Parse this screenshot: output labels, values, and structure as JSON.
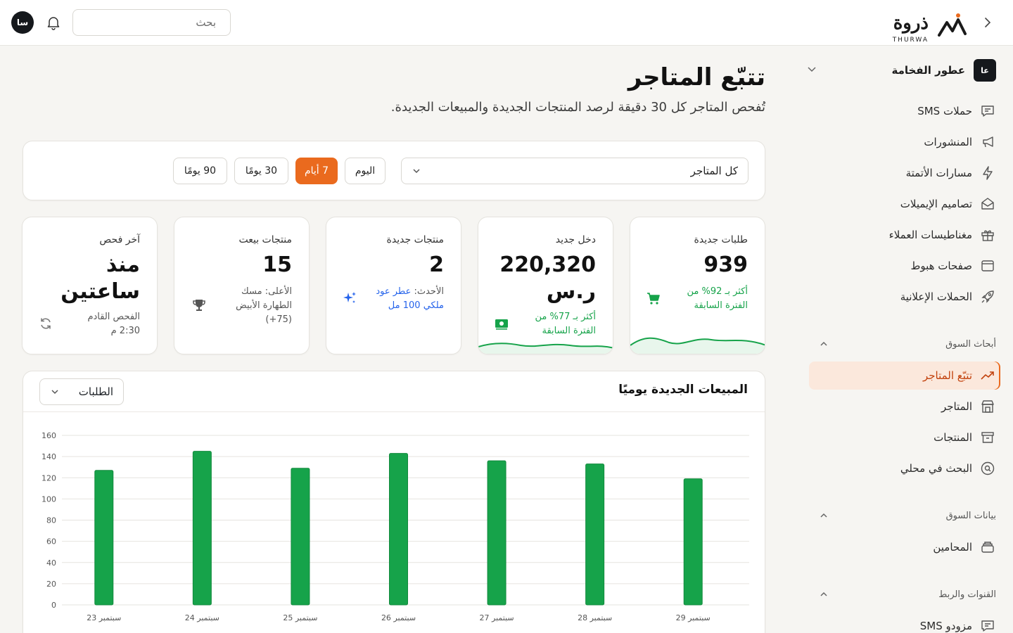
{
  "brand": {
    "name": "ذروة",
    "latin": "THURWA"
  },
  "header": {
    "search_placeholder": "بحث",
    "avatar_initials": "سا"
  },
  "sidebar": {
    "store": {
      "badge": "عا",
      "name": "عطور الفخامة"
    },
    "items": [
      {
        "label": "حملات SMS",
        "icon": "message-icon"
      },
      {
        "label": "المنشورات",
        "icon": "megaphone-icon"
      },
      {
        "label": "مسارات الأتمتة",
        "icon": "lightning-icon"
      },
      {
        "label": "تصاميم الإيميلات",
        "icon": "envelope-icon"
      },
      {
        "label": "مغناطيسات العملاء",
        "icon": "gift-icon"
      },
      {
        "label": "صفحات هبوط",
        "icon": "browser-icon"
      },
      {
        "label": "الحملات الإعلانية",
        "icon": "rocket-icon"
      }
    ],
    "sections": [
      {
        "title": "أبحاث السوق",
        "items": [
          {
            "label": "تتبّع المتاجر",
            "icon": "trend-icon",
            "active": true
          },
          {
            "label": "المتاجر",
            "icon": "store-icon"
          },
          {
            "label": "المنتجات",
            "icon": "archive-icon"
          },
          {
            "label": "البحث في محلي",
            "icon": "search-circle-icon"
          }
        ]
      },
      {
        "title": "بيانات السوق",
        "items": [
          {
            "label": "المحامين",
            "icon": "stack-icon"
          }
        ]
      },
      {
        "title": "القنوات والربط",
        "items": [
          {
            "label": "مزودو SMS",
            "icon": "message-icon"
          }
        ]
      }
    ]
  },
  "page": {
    "title": "تتبّع المتاجر",
    "subtitle": "تُفحص المتاجر كل 30 دقيقة لرصد المنتجات الجديدة والمبيعات الجديدة."
  },
  "filters": {
    "store_select": "كل المتاجر",
    "ranges": [
      "اليوم",
      "7 أيام",
      "30 يومًا",
      "90 يومًا"
    ],
    "selected_range": "7 أيام"
  },
  "stats": {
    "orders": {
      "label": "طلبات جديدة",
      "value": "939",
      "note_line1": "أكثر بـ 92% من",
      "note_line2": "الفترة السابقة"
    },
    "income": {
      "label": "دخل جديد",
      "value_line1": "220,320",
      "value_line2": "ر.س",
      "note_line1": "أكثر بـ 77% من",
      "note_line2": "الفترة السابقة"
    },
    "new_products": {
      "label": "منتجات جديدة",
      "value": "2",
      "note_prefix": "الأحدث:",
      "note_line1": " عطر عود",
      "note_line2": "ملكي 100 مل"
    },
    "sold_products": {
      "label": "منتجات بيعت",
      "value": "15",
      "note_line1": "الأعلى: مسك",
      "note_line2": "الطهارة الأبيض",
      "note_line3": "(75+)"
    },
    "last_check": {
      "label": "آخر فحص",
      "value_line1": "منذ",
      "value_line2": "ساعتين",
      "note_line1": "الفحص القادم",
      "note_line2": "2:30 م"
    }
  },
  "chart": {
    "title": "المبيعات الجديدة يوميًا",
    "metric_select": "الطلبات"
  },
  "colors": {
    "accent": "#ea6a1e",
    "bar": "#16a34a",
    "positive": "#16a34a",
    "info": "#2563eb"
  },
  "chart_data": {
    "type": "bar",
    "categories": [
      "23 سبتمبر",
      "24 سبتمبر",
      "25 سبتمبر",
      "26 سبتمبر",
      "27 سبتمبر",
      "28 سبتمبر",
      "29 سبتمبر"
    ],
    "values": [
      127,
      145,
      129,
      143,
      136,
      133,
      119
    ],
    "ylim": [
      0,
      160
    ],
    "yticks": [
      0,
      20,
      40,
      60,
      80,
      100,
      120,
      140,
      160
    ],
    "grid": true
  }
}
